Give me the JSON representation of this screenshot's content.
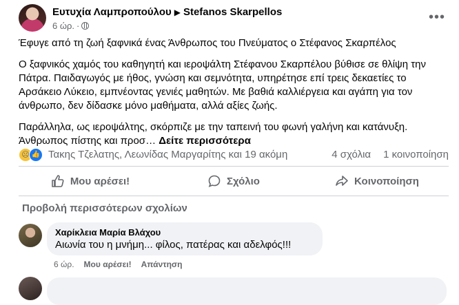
{
  "post": {
    "author": "Ευτυχία Λαμπροπούλου",
    "target": "Stefanos Skarpellos",
    "time": "6 ώρ.",
    "body": [
      "Έφυγε από τη ζωή ξαφνικά ένας Άνθρωπος του Πνεύματος ο Στέφανος Σκαρπέλος",
      "Ο ξαφνικός χαμός του καθηγητή και ιεροψάλτη Στέφανου Σκαρπέλου βύθισε σε θλίψη την Πάτρα. Παιδαγωγός με ήθος, γνώση και σεμνότητα, υπηρέτησε επί τρεις δεκαετίες το Αρσάκειο Λύκειο, εμπνέοντας γενιές μαθητών. Με βαθιά καλλιέργεια και αγάπη για τον άνθρωπο, δεν δίδασκε μόνο μαθήματα, αλλά αξίες ζωής.",
      "Παράλληλα, ως ιεροψάλτης, σκόρπιζε με την ταπεινή του φωνή γαλήνη και κατάνυξη. Άνθρωπος πίστης και προσ…"
    ],
    "see_more": "Δείτε περισσότερα"
  },
  "reactions": {
    "names": "Τακης Τζελατης, Λεωνίδας Μαργαρίτης και 19 ακόμη",
    "comments_count": "4 σχόλια",
    "shares_count": "1 κοινοποίηση",
    "icons": [
      "sad-icon",
      "like-icon"
    ]
  },
  "actions": {
    "like": "Μου αρέσει!",
    "comment": "Σχόλιο",
    "share": "Κοινοποίηση"
  },
  "comments": {
    "view_more": "Προβολή περισσότερων σχολίων",
    "items": [
      {
        "author": "Χαρίκλεια Μαρία Βλάχου",
        "text": "Αιωνία του η μνήμη... φίλος, πατέρας και αδελφός!!!",
        "time": "6 ώρ.",
        "like": "Μου αρέσει!",
        "reply": "Απάντηση"
      }
    ]
  },
  "colors": {
    "accent": "#1877f2",
    "secondary_text": "#65676b",
    "bubble": "#f0f2f5"
  }
}
